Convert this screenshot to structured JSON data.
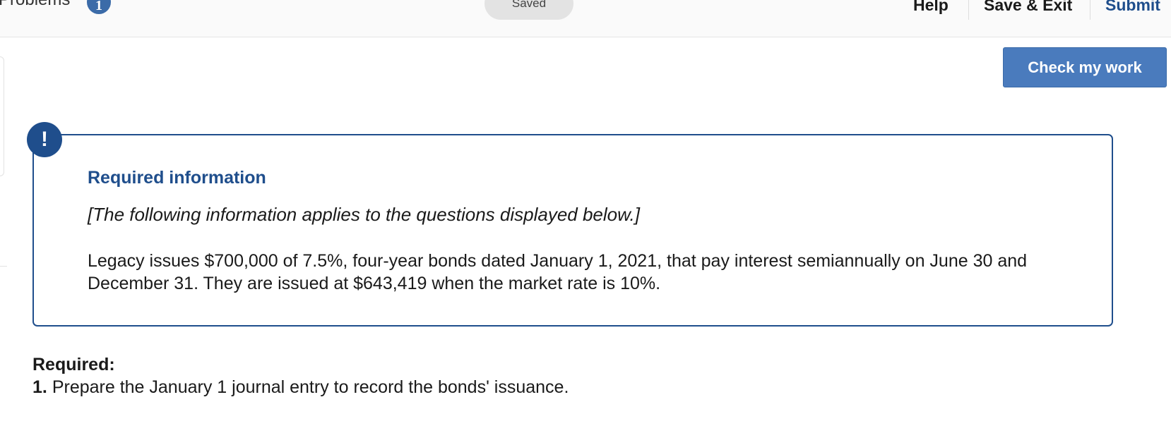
{
  "topbar": {
    "problems_label": "Problems",
    "problems_count": "1",
    "status": "Saved",
    "help_label": "Help",
    "save_exit_label": "Save & Exit",
    "submit_label": "Submit"
  },
  "toolbar": {
    "check_work_label": "Check my work"
  },
  "info_box": {
    "icon": "exclamation-icon",
    "icon_glyph": "!",
    "title": "Required information",
    "note": "[The following information applies to the questions displayed below.]",
    "body": "Legacy issues $700,000 of 7.5%, four-year bonds dated January 1, 2021, that pay interest semiannually on June 30 and December 31. They are issued at $643,419 when the market rate is 10%."
  },
  "required": {
    "label": "Required:",
    "item_number": "1.",
    "item_text": "Prepare the January 1 journal entry to record the bonds' issuance."
  },
  "colors": {
    "accent": "#1f4e8c",
    "button": "#4a7bbd"
  }
}
